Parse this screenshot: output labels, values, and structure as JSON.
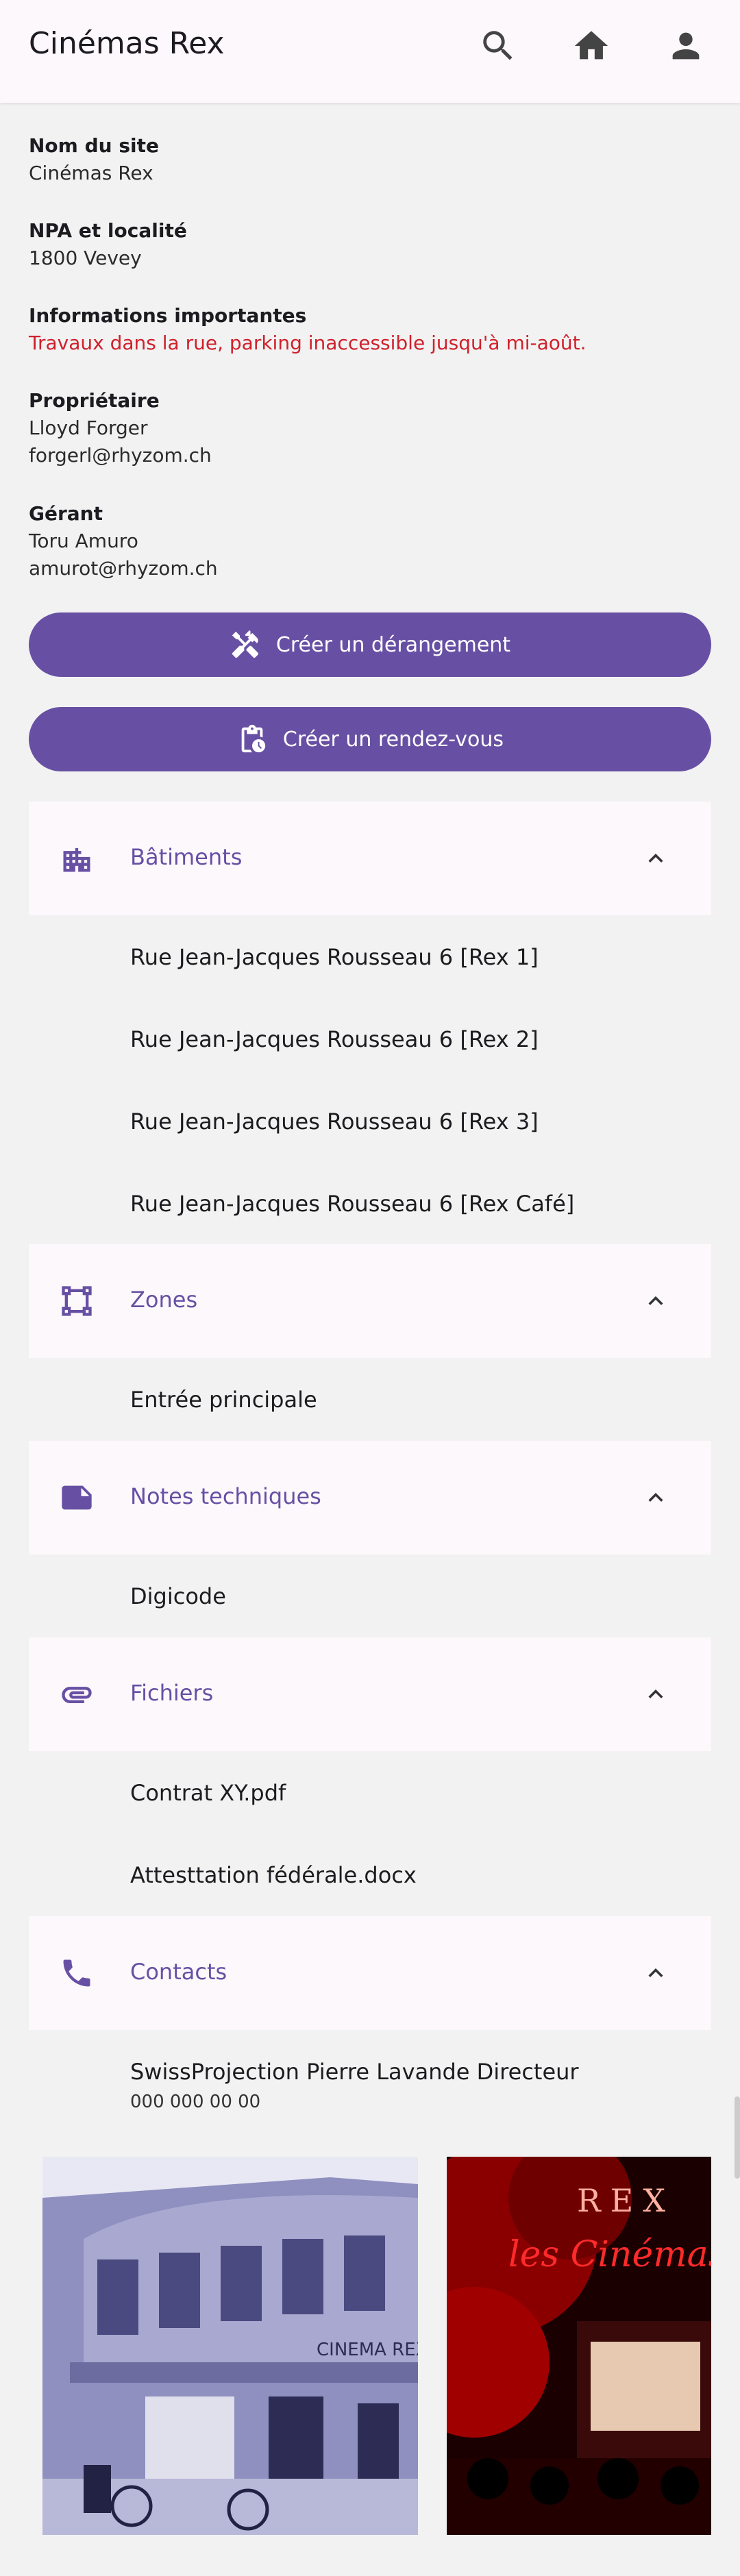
{
  "appbar": {
    "title": "Cinémas Rex",
    "icons": [
      "search-icon",
      "home-icon",
      "account-icon"
    ]
  },
  "site": {
    "name_label": "Nom du site",
    "name_value": "Cinémas Rex",
    "npa_label": "NPA et localité",
    "npa_value": "1800 Vevey",
    "info_label": "Informations importantes",
    "info_value": "Travaux dans la rue, parking inaccessible jusqu'à mi-août.",
    "owner_label": "Propriétaire",
    "owner_name": "Lloyd Forger",
    "owner_email": "forgerl@rhyzom.ch",
    "manager_label": "Gérant",
    "manager_name": "Toru Amuro",
    "manager_email": "amurot@rhyzom.ch"
  },
  "actions": {
    "incident_label": "Créer un dérangement",
    "appointment_label": "Créer un rendez-vous"
  },
  "sections": {
    "buildings": {
      "title": "Bâtiments",
      "items": [
        "Rue Jean-Jacques Rousseau 6 [Rex 1]",
        "Rue Jean-Jacques Rousseau 6 [Rex 2]",
        "Rue Jean-Jacques Rousseau 6 [Rex 3]",
        "Rue Jean-Jacques Rousseau 6 [Rex Café]"
      ]
    },
    "zones": {
      "title": "Zones",
      "items": [
        "Entrée principale"
      ]
    },
    "notes": {
      "title": "Notes techniques",
      "items": [
        "Digicode"
      ]
    },
    "files": {
      "title": "Fichiers",
      "items": [
        "Contrat XY.pdf",
        "Attesttation fédérale.docx"
      ]
    },
    "contacts": {
      "title": "Contacts",
      "items": [
        {
          "name": "SwissProjection Pierre Lavande Directeur",
          "phone": "000 000 00 00"
        }
      ]
    }
  },
  "photos": {
    "photo1_sign": "CINEMA REX",
    "photo2_sign_top": "REX",
    "photo2_sign_script": "les Cinémas"
  },
  "colors": {
    "primary": "#6750a4",
    "alert": "#d0202b",
    "surface": "#fdf8fb",
    "background": "#f2f2f2"
  }
}
